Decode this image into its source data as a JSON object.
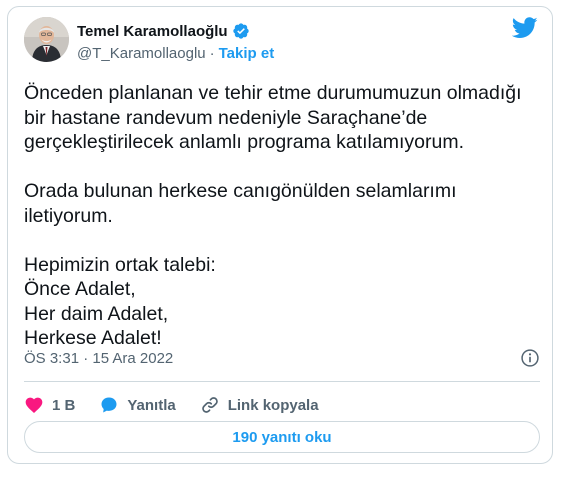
{
  "author": {
    "display_name": "Temel Karamollaoğlu",
    "handle": "@T_Karamollaoglu",
    "separator": "·",
    "follow_label": "Takip et"
  },
  "tweet": {
    "text": "Önceden planlanan ve tehir etme durumumuzun olmadığı\nbir hastane randevum nedeniyle Saraçhane’de\ngerçekleştirilecek anlamlı programa katılamıyorum.\n\nOrada bulunan herkese canıgönülden selamlarımı\niletiyorum.\n\nHepimizin ortak talebi:\nÖnce Adalet,\nHer daim Adalet,\nHerkese Adalet!",
    "timestamp": "ÖS 3:31 · 15 Ara 2022"
  },
  "actions": {
    "like_count": "1 B",
    "reply_label": "Yanıtla",
    "copy_link_label": "Link kopyala"
  },
  "replies_button_label": "190 yanıtı oku",
  "colors": {
    "accent": "#1d9bf0",
    "like": "#f91880",
    "secondary_text": "#536471",
    "border": "#cfd9de"
  },
  "icons": [
    "verified-badge-icon",
    "twitter-bird-icon",
    "info-icon",
    "heart-icon",
    "reply-bubble-icon",
    "link-icon"
  ]
}
